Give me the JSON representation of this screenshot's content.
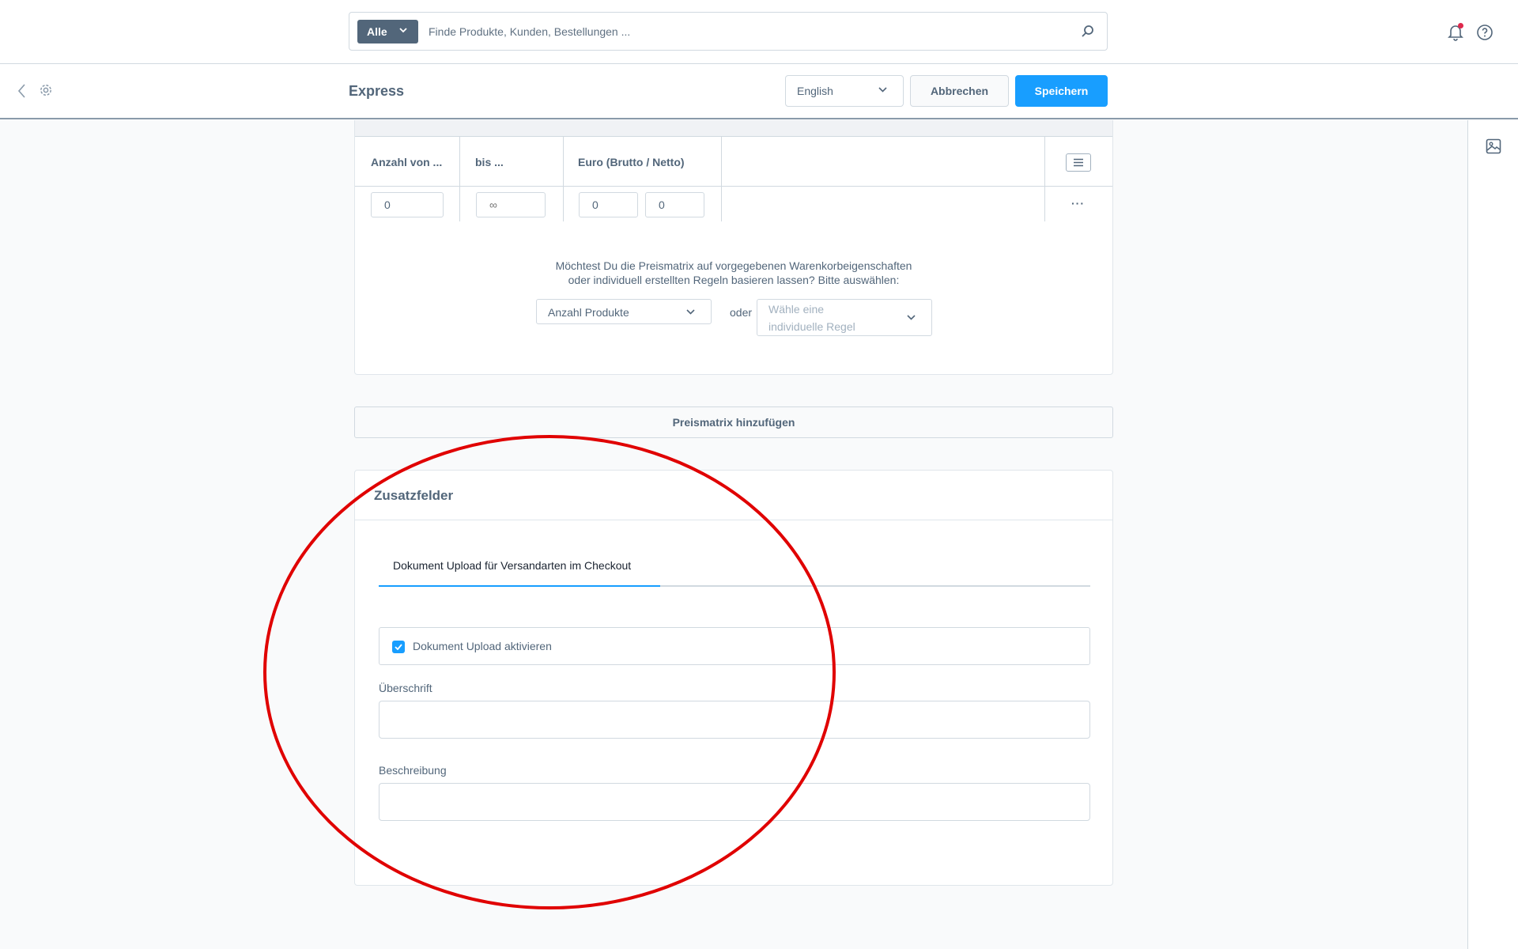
{
  "search": {
    "type_label": "Alle",
    "placeholder": "Finde Produkte, Kunden, Bestellungen ..."
  },
  "smartbar": {
    "title": "Express",
    "language": "English",
    "cancel_label": "Abbrechen",
    "save_label": "Speichern"
  },
  "price_matrix": {
    "columns": [
      "Anzahl von ...",
      "bis ...",
      "Euro (Brutto / Netto)"
    ],
    "row": {
      "from": "0",
      "to_placeholder": "∞",
      "gross": "0",
      "net": "0",
      "actions": "···"
    },
    "rule_prompt_line1": "Möchtest Du die Preismatrix auf vorgegebenen Warenkorbeigenschaften",
    "rule_prompt_line2": "oder individuell erstellten Regeln basieren lassen? Bitte auswählen:",
    "rule_select_value": "Anzahl Produkte",
    "or_label": "oder",
    "custom_rule_placeholder_line1": "Wähle eine",
    "custom_rule_placeholder_line2": "individuelle Regel",
    "add_button_label": "Preismatrix hinzufügen"
  },
  "custom_fields": {
    "title": "Zusatzfelder",
    "tab_label": "Dokument Upload für Versandarten im Checkout",
    "checkbox_label": "Dokument Upload aktivieren",
    "checkbox_checked": true,
    "heading_label": "Überschrift",
    "heading_value": "",
    "description_label": "Beschreibung",
    "description_value": ""
  },
  "colors": {
    "primary": "#189eff",
    "text": "#52667a",
    "border": "#d1d9e0",
    "annotation": "#e00000",
    "notification_dot": "#de294c"
  }
}
